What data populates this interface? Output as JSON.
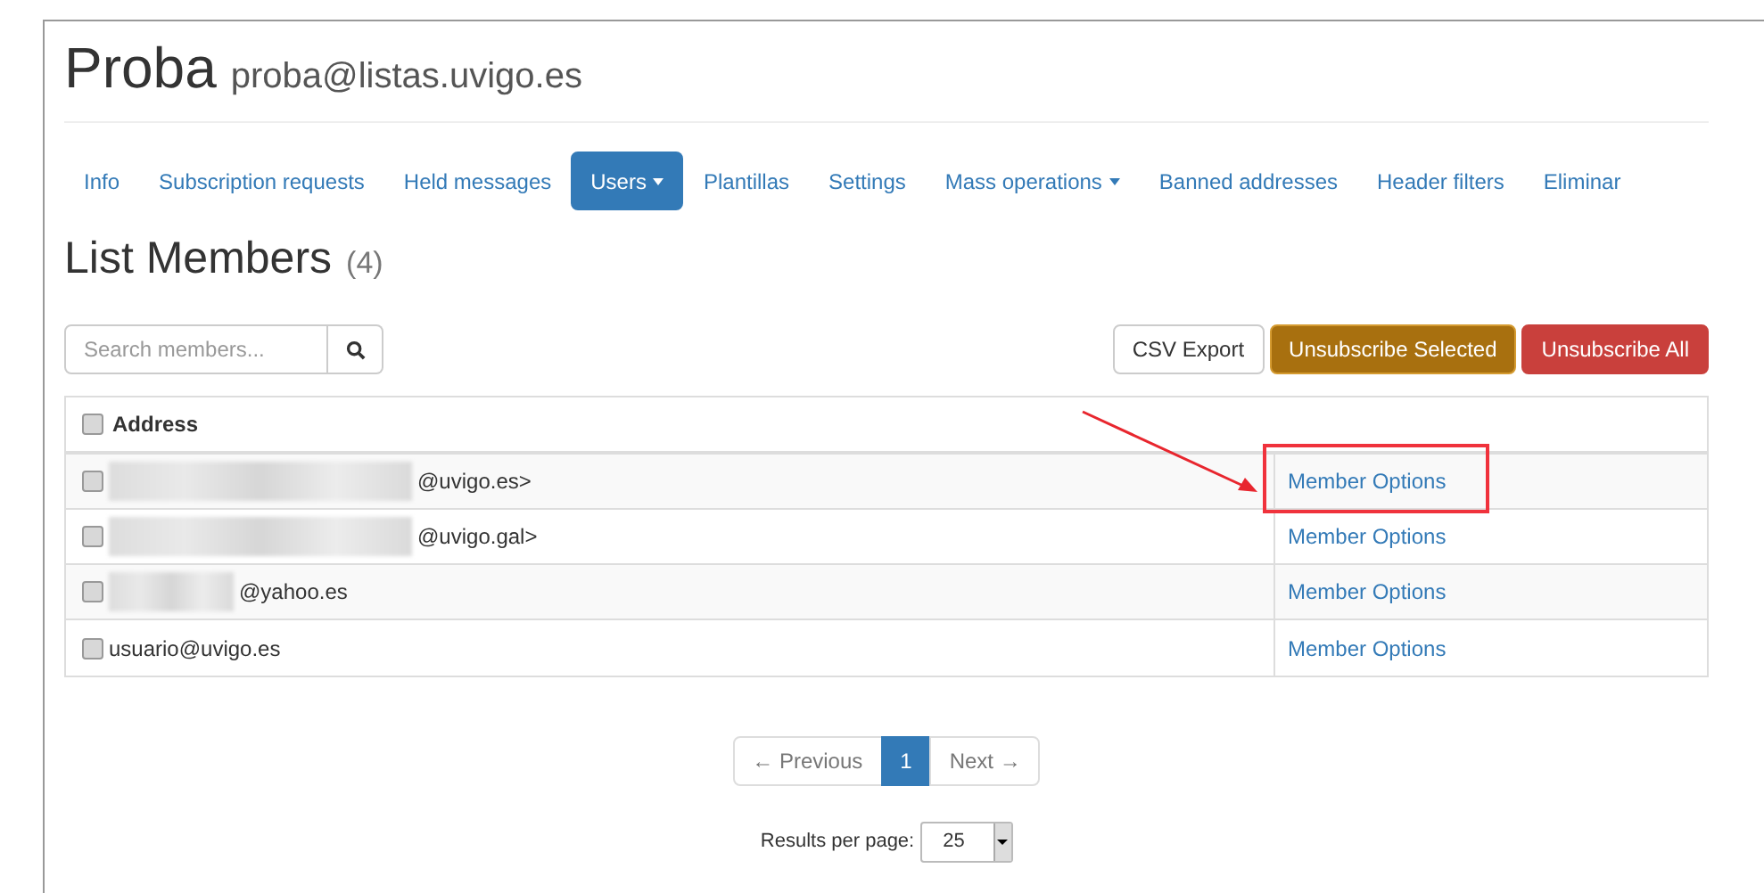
{
  "header": {
    "title": "Proba",
    "subtitle": "proba@listas.uvigo.es"
  },
  "nav": [
    {
      "label": "Info",
      "selected": false,
      "dropdown": false
    },
    {
      "label": "Subscription requests",
      "selected": false,
      "dropdown": false
    },
    {
      "label": "Held messages",
      "selected": false,
      "dropdown": false
    },
    {
      "label": "Users",
      "selected": true,
      "dropdown": true
    },
    {
      "label": "Plantillas",
      "selected": false,
      "dropdown": false
    },
    {
      "label": "Settings",
      "selected": false,
      "dropdown": false
    },
    {
      "label": "Mass operations",
      "selected": false,
      "dropdown": true
    },
    {
      "label": "Banned addresses",
      "selected": false,
      "dropdown": false
    },
    {
      "label": "Header filters",
      "selected": false,
      "dropdown": false
    },
    {
      "label": "Eliminar",
      "selected": false,
      "dropdown": false
    }
  ],
  "heading": {
    "title": "List Members",
    "count": "(4)"
  },
  "search": {
    "placeholder": "Search members..."
  },
  "actions": [
    {
      "label": "CSV Export",
      "kind": "default"
    },
    {
      "label": "Unsubscribe Selected",
      "kind": "warning"
    },
    {
      "label": "Unsubscribe All",
      "kind": "danger"
    }
  ],
  "table": {
    "columns": [
      {
        "label": "Address",
        "checked": false
      }
    ],
    "rows": [
      {
        "address": "@uvigo.es>",
        "redacted": true,
        "checked": false,
        "action": "Member Options",
        "highlighted": true
      },
      {
        "address": "@uvigo.gal>",
        "redacted": true,
        "checked": false,
        "action": "Member Options",
        "highlighted": false
      },
      {
        "address": "@yahoo.es",
        "redacted": true,
        "checked": false,
        "action": "Member Options",
        "highlighted": false
      },
      {
        "address": "usuario@uvigo.es",
        "redacted": false,
        "checked": false,
        "action": "Member Options",
        "highlighted": false
      }
    ]
  },
  "pagination": [
    {
      "label": "← Previous",
      "selected": false
    },
    {
      "label": "1",
      "selected": true
    },
    {
      "label": "Next →",
      "selected": false
    }
  ],
  "per_page": {
    "label": "Results per page:",
    "value": "25"
  }
}
